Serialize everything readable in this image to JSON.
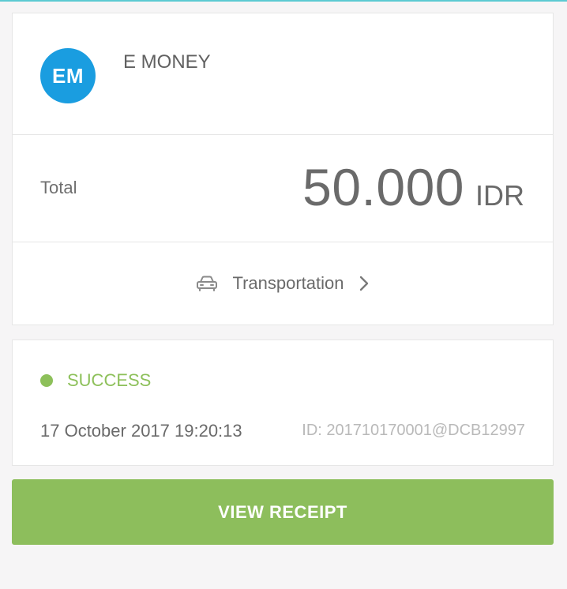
{
  "merchant": {
    "avatar_initials": "EM",
    "name": "E MONEY"
  },
  "total": {
    "label": "Total",
    "amount": "50.000",
    "currency": "IDR"
  },
  "category": {
    "icon": "car-icon",
    "label": "Transportation",
    "chevron_icon": "chevron-right-icon"
  },
  "transaction": {
    "status": "SUCCESS",
    "date": "17 October 2017 19:20:13",
    "id": "ID: 201710170001@DCB12997"
  },
  "actions": {
    "view_receipt_label": "VIEW RECEIPT"
  },
  "colors": {
    "avatar": "#1a9de0",
    "success": "#8dc05a",
    "button": "#8dbe5c",
    "top_accent": "#5ccad2"
  }
}
